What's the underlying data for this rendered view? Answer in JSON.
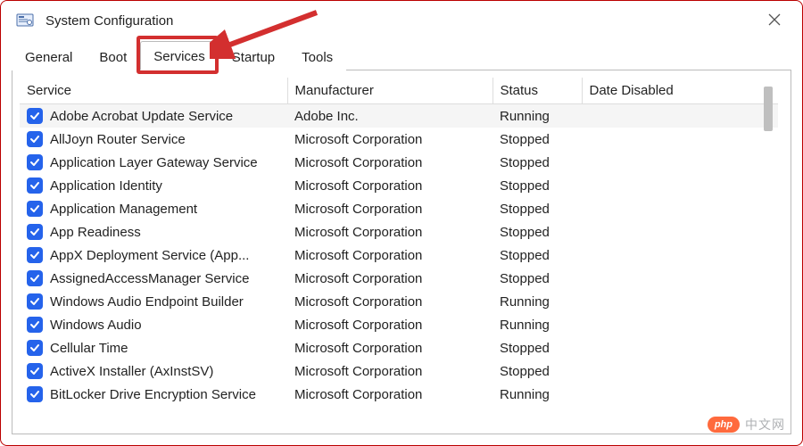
{
  "window": {
    "title": "System Configuration"
  },
  "tabs": [
    {
      "label": "General",
      "active": false
    },
    {
      "label": "Boot",
      "active": false
    },
    {
      "label": "Services",
      "active": true
    },
    {
      "label": "Startup",
      "active": false
    },
    {
      "label": "Tools",
      "active": false
    }
  ],
  "columns": {
    "service": "Service",
    "manufacturer": "Manufacturer",
    "status": "Status",
    "date_disabled": "Date Disabled"
  },
  "services": [
    {
      "checked": true,
      "name": "Adobe Acrobat Update Service",
      "manufacturer": "Adobe Inc.",
      "status": "Running",
      "date_disabled": ""
    },
    {
      "checked": true,
      "name": "AllJoyn Router Service",
      "manufacturer": "Microsoft Corporation",
      "status": "Stopped",
      "date_disabled": ""
    },
    {
      "checked": true,
      "name": "Application Layer Gateway Service",
      "manufacturer": "Microsoft Corporation",
      "status": "Stopped",
      "date_disabled": ""
    },
    {
      "checked": true,
      "name": "Application Identity",
      "manufacturer": "Microsoft Corporation",
      "status": "Stopped",
      "date_disabled": ""
    },
    {
      "checked": true,
      "name": "Application Management",
      "manufacturer": "Microsoft Corporation",
      "status": "Stopped",
      "date_disabled": ""
    },
    {
      "checked": true,
      "name": "App Readiness",
      "manufacturer": "Microsoft Corporation",
      "status": "Stopped",
      "date_disabled": ""
    },
    {
      "checked": true,
      "name": "AppX Deployment Service (App...",
      "manufacturer": "Microsoft Corporation",
      "status": "Stopped",
      "date_disabled": ""
    },
    {
      "checked": true,
      "name": "AssignedAccessManager Service",
      "manufacturer": "Microsoft Corporation",
      "status": "Stopped",
      "date_disabled": ""
    },
    {
      "checked": true,
      "name": "Windows Audio Endpoint Builder",
      "manufacturer": "Microsoft Corporation",
      "status": "Running",
      "date_disabled": ""
    },
    {
      "checked": true,
      "name": "Windows Audio",
      "manufacturer": "Microsoft Corporation",
      "status": "Running",
      "date_disabled": ""
    },
    {
      "checked": true,
      "name": "Cellular Time",
      "manufacturer": "Microsoft Corporation",
      "status": "Stopped",
      "date_disabled": ""
    },
    {
      "checked": true,
      "name": "ActiveX Installer (AxInstSV)",
      "manufacturer": "Microsoft Corporation",
      "status": "Stopped",
      "date_disabled": ""
    },
    {
      "checked": true,
      "name": "BitLocker Drive Encryption Service",
      "manufacturer": "Microsoft Corporation",
      "status": "Running",
      "date_disabled": ""
    }
  ],
  "watermark": {
    "badge": "php",
    "text": "中文网"
  },
  "colors": {
    "highlight": "#d32f2f",
    "checkbox": "#2563eb"
  }
}
